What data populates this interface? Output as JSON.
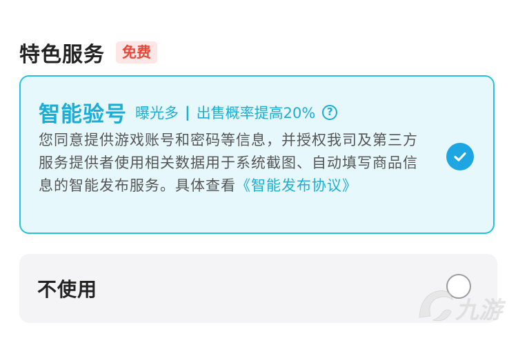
{
  "section": {
    "title": "特色服务",
    "badge": "免费"
  },
  "option_smart": {
    "title": "智能验号",
    "tag_exposure": "曝光多",
    "tag_separator": "|",
    "tag_sale": "出售概率提高20%",
    "help_icon": "question-circle-icon",
    "description": "您同意提供游戏账号和密码等信息，并授权我司及第三方服务提供者使用相关数据用于系统截图、自动填写商品信息的智能发布服务。具体查看",
    "agreement_link": "《智能发布协议》",
    "selected": true,
    "check_icon": "check-circle-icon"
  },
  "option_none": {
    "label": "不使用",
    "selected": false
  },
  "colors": {
    "accent": "#1aaed6",
    "card_border": "#26c1dc",
    "card_bg": "#e7f8fc",
    "badge_text": "#e8483a",
    "badge_bg": "#fde6e4",
    "check_bg": "#1ea6e2"
  },
  "watermark": {
    "icon": "jiuyou-logo-icon",
    "text": "九游"
  }
}
